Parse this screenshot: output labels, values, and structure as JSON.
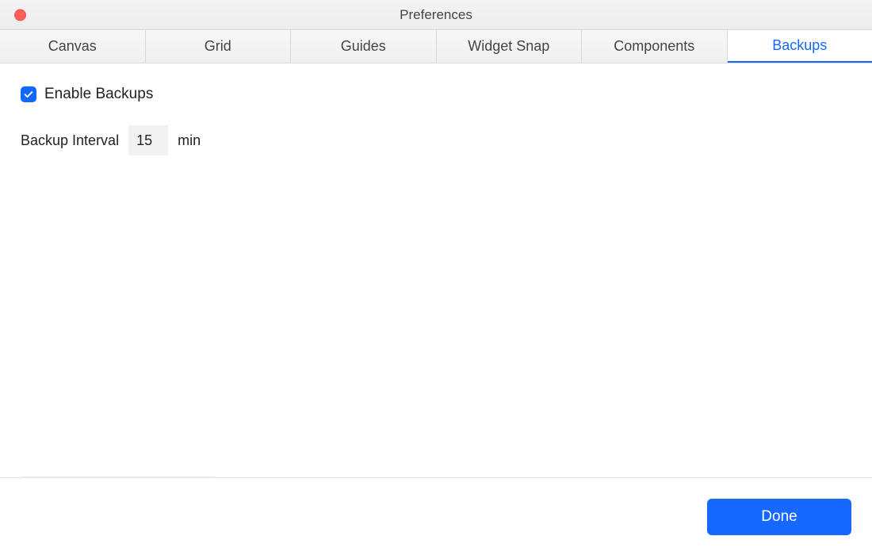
{
  "window": {
    "title": "Preferences"
  },
  "tabs": [
    {
      "label": "Canvas"
    },
    {
      "label": "Grid"
    },
    {
      "label": "Guides"
    },
    {
      "label": "Widget Snap"
    },
    {
      "label": "Components"
    },
    {
      "label": "Backups",
      "active": true
    }
  ],
  "backups": {
    "enable_label": "Enable Backups",
    "enable_checked": true,
    "interval_label": "Backup Interval",
    "interval_value": "15",
    "interval_unit": "min"
  },
  "footer": {
    "done_label": "Done"
  },
  "colors": {
    "accent": "#1768ff"
  }
}
